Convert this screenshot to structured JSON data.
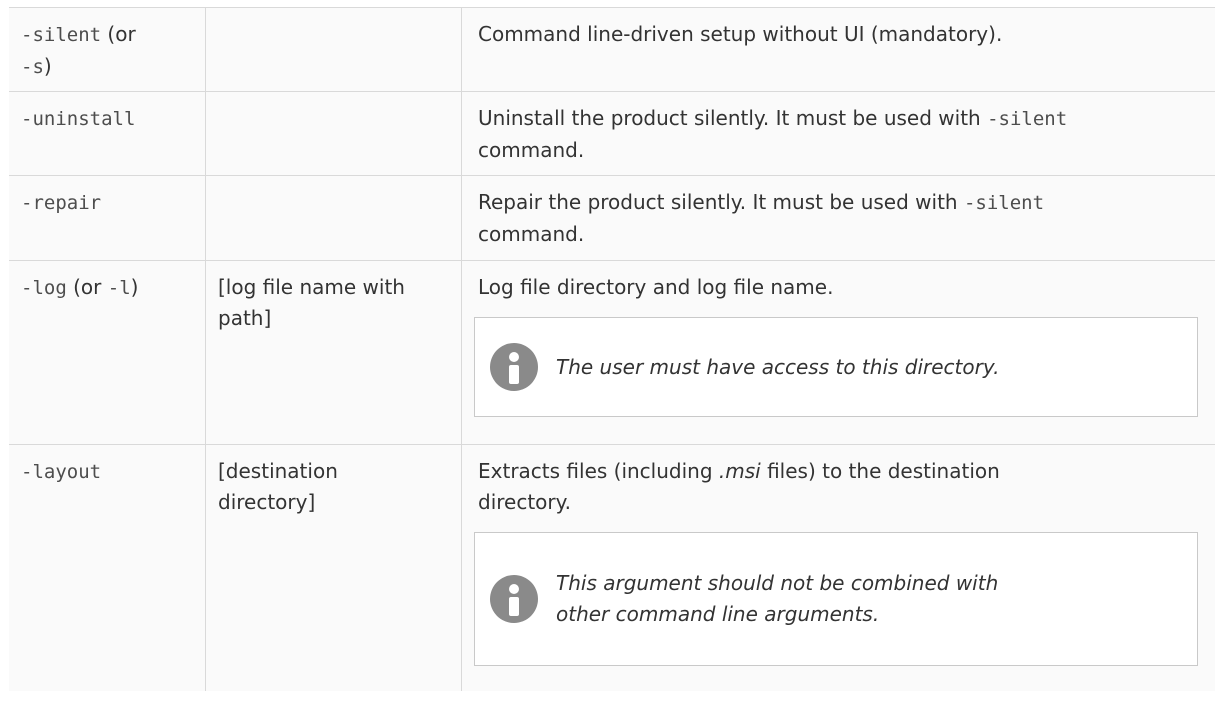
{
  "rows": [
    {
      "arg": "-silent",
      "arg_suffix": " (or",
      "arg_alt": "-s",
      "arg_alt_suffix": ")",
      "value": "",
      "desc": "Command line-driven setup without UI (mandatory)."
    },
    {
      "arg": "-uninstall",
      "value": "",
      "desc_pre": "Uninstall the product silently. It must be used with ",
      "desc_code": "-silent",
      "desc_post": "command."
    },
    {
      "arg": "-repair",
      "value": "",
      "desc_pre": "Repair the product silently. It must be used with ",
      "desc_code": "-silent",
      "desc_post": "command."
    },
    {
      "arg": "-log",
      "arg_mid": " (or ",
      "arg_alt": "-l",
      "arg_alt_suffix": ")",
      "value_line1": "[log file name with",
      "value_line2": "path]",
      "desc": "Log file directory and log file name.",
      "note": "The user must have access to this directory.",
      "note_icon": "info-icon"
    },
    {
      "arg": "-layout",
      "value_line1": "[destination",
      "value_line2": "directory]",
      "desc_pre": "Extracts files (including ",
      "desc_em": ".msi",
      "desc_post": " files) to the destination directory.",
      "note_line1": "This argument should not be combined with",
      "note_line2": "other command line arguments.",
      "note_icon": "info-icon"
    }
  ],
  "colors": {
    "row_background": "#fafafa",
    "border": "#d9d9d9",
    "note_icon": "#8a8a8a",
    "text": "#333333"
  }
}
